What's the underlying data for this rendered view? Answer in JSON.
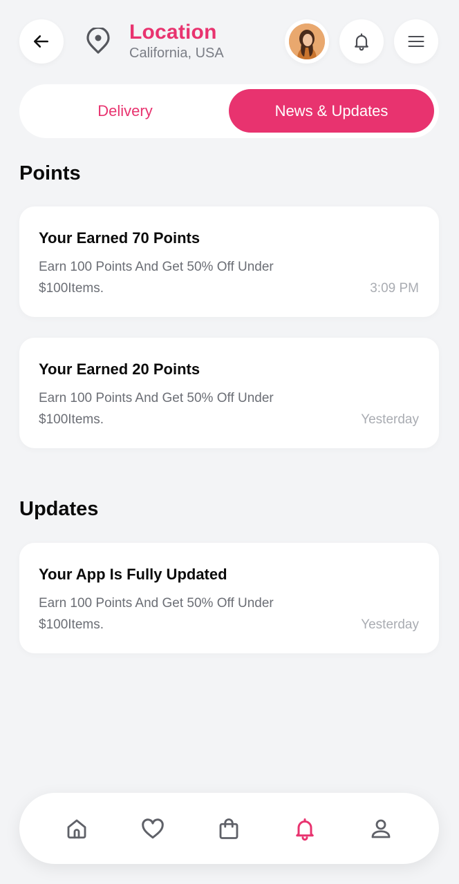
{
  "header": {
    "location_title": "Location",
    "location_subtitle": "California, USA",
    "icons": [
      "back-arrow-icon",
      "map-pin-icon",
      "avatar",
      "bell-icon",
      "menu-icon"
    ]
  },
  "tabs": {
    "items": [
      "Delivery",
      "News & Updates"
    ],
    "active": "News & Updates"
  },
  "points": {
    "section_title": "Points",
    "cards": [
      {
        "title": "Your Earned 70 Points",
        "description": "Earn 100 Points And Get 50% Off Under $100Items.",
        "time": "3:09 PM"
      },
      {
        "title": "Your Earned 20 Points",
        "description": "Earn 100 Points And Get 50% Off Under $100Items.",
        "time": "Yesterday"
      }
    ]
  },
  "updates": {
    "section_title": "Updates",
    "cards": [
      {
        "title": "Your App Is Fully Updated",
        "description": "Earn 100 Points And Get 50% Off Under $100Items.",
        "time": "Yesterday"
      }
    ]
  },
  "bottom_nav": {
    "items": [
      "home-icon",
      "heart-icon",
      "bag-icon",
      "bell-icon",
      "user-icon"
    ],
    "active": "bell-icon"
  },
  "colors": {
    "accent": "#e8336f",
    "background": "#f3f4f6",
    "card": "#ffffff",
    "icon_gray": "#5f6168"
  }
}
